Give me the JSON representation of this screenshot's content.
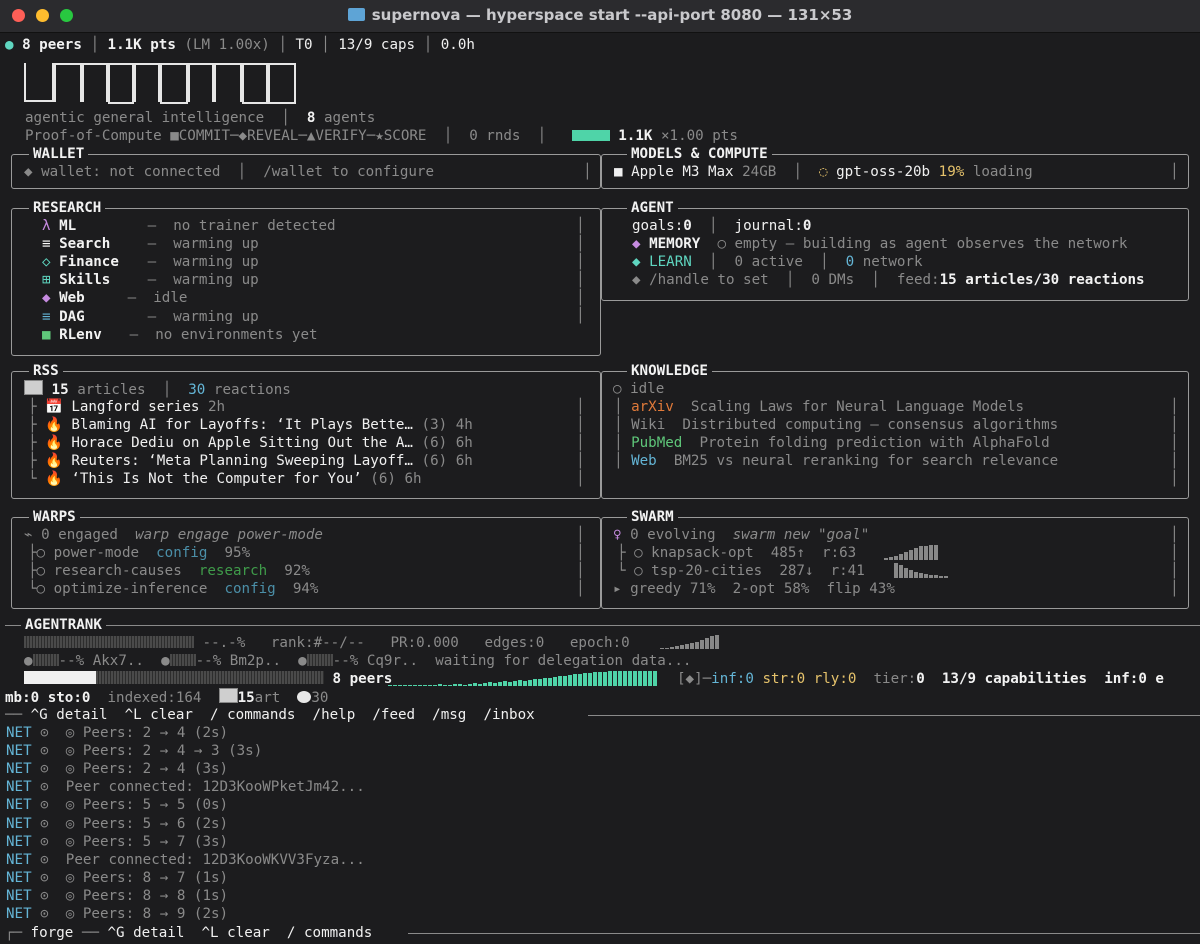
{
  "window": {
    "title": "supernova — hyperspace start --api-port 8080 — 131×53"
  },
  "status": {
    "peers": "8 peers",
    "pts": "1.1K pts",
    "lm": "(LM 1.00x)",
    "tier": "T0",
    "caps": "13/9 caps",
    "hours": "0.0h"
  },
  "logo": {
    "text": "HYPERSPACE"
  },
  "header": {
    "tagline": "agentic general intelligence",
    "agents_count": "8",
    "agents_label": "agents",
    "poc": "Proof-of-Compute ■COMMIT─◆REVEAL─▲VERIFY─★SCORE",
    "rounds": "0 rnds",
    "points": "1.1K",
    "mult": "×1.00 pts"
  },
  "wallet": {
    "title": "WALLET",
    "status": "◆ wallet: not connected",
    "hint": "/wallet to configure"
  },
  "models": {
    "title": "MODELS & COMPUTE",
    "device": "Apple M3 Max",
    "memory": "24GB",
    "model": "gpt-oss-20b",
    "progress_label": "19%",
    "state": "loading"
  },
  "research": {
    "title": "RESEARCH",
    "items": [
      {
        "icon": "λ",
        "name": "ML",
        "status": "—  no trainer detected"
      },
      {
        "icon": "≡",
        "name": "Search",
        "status": "—  warming up"
      },
      {
        "icon": "◇",
        "name": "Finance",
        "status": "—  warming up"
      },
      {
        "icon": "⊞",
        "name": "Skills",
        "status": "—  warming up"
      },
      {
        "icon": "◆",
        "name": "Web",
        "status": "—  idle"
      },
      {
        "icon": "≡",
        "name": "DAG",
        "status": "—  warming up"
      },
      {
        "icon": "■",
        "name": "RLenv",
        "status": "—  no environments yet"
      }
    ]
  },
  "agent": {
    "title": "AGENT",
    "goals_label": "goals:",
    "goals": "0",
    "journal_label": "journal:",
    "journal": "0",
    "memory_label": "MEMORY",
    "memory_status": "○ empty — building as agent observes the network",
    "learn_label": "LEARN",
    "learn_active": "0 active",
    "learn_network_count": "0",
    "learn_network_label": "network",
    "handle": "◆ /handle to set",
    "dms": "0 DMs",
    "feed_label": "feed:",
    "feed": "15 articles/30 reactions"
  },
  "rss": {
    "title": "RSS",
    "articles_count": "15",
    "articles_label": "articles",
    "reactions_count": "30",
    "reactions_label": "reactions",
    "items": [
      {
        "icon": "📅",
        "title": "Langford series",
        "count": "",
        "age": "2h"
      },
      {
        "icon": "🔥",
        "title": "Blaming AI for Layoffs: ‘It Plays Bette…",
        "count": "(3)",
        "age": "4h"
      },
      {
        "icon": "🔥",
        "title": "Horace Dediu on Apple Sitting Out the A…",
        "count": "(6)",
        "age": "6h"
      },
      {
        "icon": "🔥",
        "title": "Reuters: ‘Meta Planning Sweeping Layoff…",
        "count": "(6)",
        "age": "6h"
      },
      {
        "icon": "🔥",
        "title": "‘This Is Not the Computer for You’",
        "count": "(6)",
        "age": "6h"
      }
    ]
  },
  "knowledge": {
    "title": "KNOWLEDGE",
    "status": "○ idle",
    "items": [
      {
        "source": "arXiv",
        "color": "#e07a3a",
        "text": "Scaling Laws for Neural Language Models"
      },
      {
        "source": "Wiki",
        "color": "#8a8a8a",
        "text": "Distributed computing — consensus algorithms"
      },
      {
        "source": "PubMed",
        "color": "#5fc77a",
        "text": "Protein folding prediction with AlphaFold"
      },
      {
        "source": "Web",
        "color": "#64b5d6",
        "text": "BM25 vs neural reranking for search relevance"
      }
    ]
  },
  "warps": {
    "title": "WARPS",
    "engaged": "⌁ 0 engaged",
    "hint": "warp engage power-mode",
    "items": [
      {
        "name": "power-mode",
        "tag": "config",
        "tag_color": "#4b8fa8",
        "pct": "95%"
      },
      {
        "name": "research-causes",
        "tag": "research",
        "tag_color": "#3f9b4a",
        "pct": "92%"
      },
      {
        "name": "optimize-inference",
        "tag": "config",
        "tag_color": "#4b8fa8",
        "pct": "94%"
      }
    ]
  },
  "swarm": {
    "title": "SWARM",
    "evolving": "0 evolving",
    "hint": "swarm new \"goal\"",
    "items": [
      {
        "name": "knapsack-opt",
        "score": "485↑",
        "r": "r:63"
      },
      {
        "name": "tsp-20-cities",
        "score": "287↓",
        "r": "r:41"
      }
    ],
    "summary": "▸ greedy 71%  2-opt 58%  flip 43%"
  },
  "agentrank": {
    "title": "AGENTRANK",
    "pct": "--.-%",
    "rank": "rank:#--/--",
    "pr": "PR:0.000",
    "edges": "edges:0",
    "epoch": "epoch:0",
    "delegates": [
      {
        "pct": "--%",
        "id": "Akx7.."
      },
      {
        "pct": "--%",
        "id": "Bm2p.."
      },
      {
        "pct": "--%",
        "id": "Cq9r.."
      }
    ],
    "waiting": "waiting for delegation data..."
  },
  "statusbar": {
    "peers": "8 peers",
    "bracket": "[◆]",
    "inf_label": "inf:",
    "inf": "0",
    "str_label": "str:",
    "str": "0",
    "rly_label": "rly:",
    "rly": "0",
    "tier_label": "tier:",
    "tier": "0",
    "capabilities": "13/9 capabilities",
    "inf2": "inf:0 e",
    "line2_mb": "mb:0 sto:0",
    "indexed": "indexed:164",
    "art_count": "15",
    "art_label": "art",
    "reactions": "30"
  },
  "shortcuts": {
    "items": [
      "^G detail",
      "^L clear",
      "/ commands",
      "/help",
      "/feed",
      "/msg",
      "/inbox"
    ]
  },
  "log": [
    {
      "tag": "NET",
      "text": "⊙  ◎ Peers: 2 → 4 (2s)"
    },
    {
      "tag": "NET",
      "text": "⊙  ◎ Peers: 2 → 4 → 3 (3s)"
    },
    {
      "tag": "NET",
      "text": "⊙  ◎ Peers: 2 → 4 (3s)"
    },
    {
      "tag": "NET",
      "text": "⊙  Peer connected: 12D3KooWPketJm42..."
    },
    {
      "tag": "NET",
      "text": "⊙  ◎ Peers: 5 → 5 (0s)"
    },
    {
      "tag": "NET",
      "text": "⊙  ◎ Peers: 5 → 6 (2s)"
    },
    {
      "tag": "NET",
      "text": "⊙  ◎ Peers: 5 → 7 (3s)"
    },
    {
      "tag": "NET",
      "text": "⊙  Peer connected: 12D3KooWKVV3Fyza..."
    },
    {
      "tag": "NET",
      "text": "⊙  ◎ Peers: 8 → 7 (1s)"
    },
    {
      "tag": "NET",
      "text": "⊙  ◎ Peers: 8 → 8 (1s)"
    },
    {
      "tag": "NET",
      "text": "⊙  ◎ Peers: 8 → 9 (2s)"
    }
  ],
  "forge": {
    "label": "forge",
    "items": [
      "^G detail",
      "^L clear",
      "/ commands"
    ]
  },
  "colors": {
    "accent_teal": "#5fd6c0",
    "bar_teal": "#4fd4a8",
    "net_blue": "#64b5d6",
    "magenta": "#c68be0",
    "yellow": "#e5c26b"
  }
}
